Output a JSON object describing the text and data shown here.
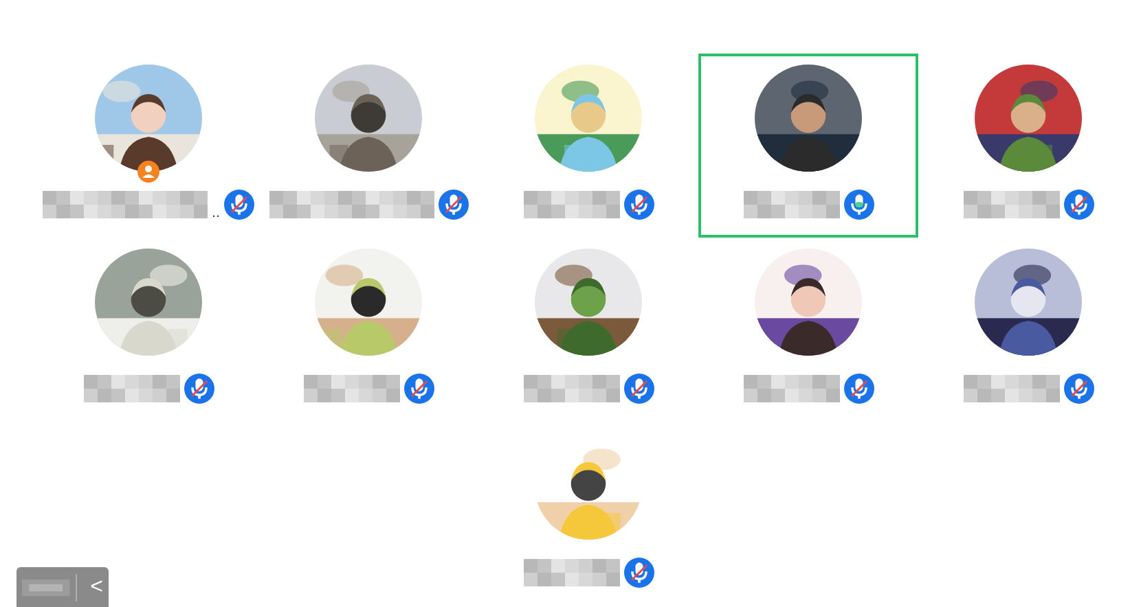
{
  "participants": [
    {
      "host": true,
      "muted": true,
      "selected": false,
      "name_tail": ".."
    },
    {
      "host": false,
      "muted": true,
      "selected": false
    },
    {
      "host": false,
      "muted": true,
      "selected": false
    },
    {
      "host": false,
      "muted": false,
      "selected": true
    },
    {
      "host": false,
      "muted": true,
      "selected": false
    },
    {
      "host": false,
      "muted": true,
      "selected": false
    },
    {
      "host": false,
      "muted": true,
      "selected": false
    },
    {
      "host": false,
      "muted": true,
      "selected": false
    },
    {
      "host": false,
      "muted": true,
      "selected": false
    },
    {
      "host": false,
      "muted": true,
      "selected": false
    },
    {
      "host": false,
      "muted": true,
      "selected": false
    }
  ],
  "bottom_bar": {
    "collapse": "<"
  }
}
